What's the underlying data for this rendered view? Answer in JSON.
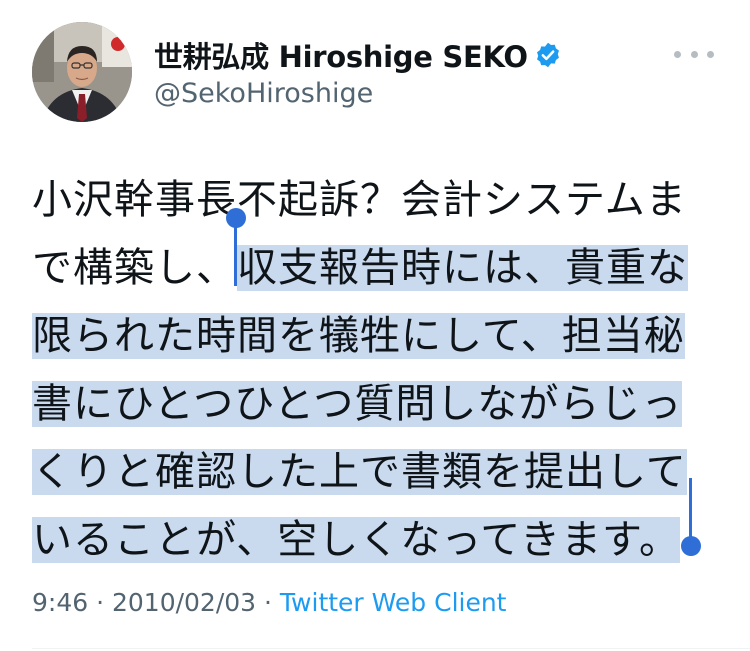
{
  "author": {
    "display_name": "世耕弘成 Hiroshige SEKO",
    "handle": "@SekoHiroshige",
    "verified": true,
    "avatar_icon": "profile-photo"
  },
  "more_icon": "ellipsis-icon",
  "tweet": {
    "lines": [
      {
        "plain": "小沢幹事長不起訴？会計システムま",
        "selected": ""
      },
      {
        "plain": "で構築し、",
        "selected": "収支報告時には、貴重な"
      },
      {
        "plain": "",
        "selected": "限られた時間を犠牲にして、担当秘"
      },
      {
        "plain": "",
        "selected": "書にひとつひとつ質問しながらじっ"
      },
      {
        "plain": "",
        "selected": "くりと確認した上で書類を提出して"
      },
      {
        "plain": "",
        "selected": "いることが、空しくなってきます。"
      }
    ]
  },
  "meta": {
    "time": "9:46",
    "separator1": " · ",
    "date": "2010/02/03",
    "separator2": " · ",
    "client": "Twitter Web Client"
  },
  "colors": {
    "selection": "#c9d9ee",
    "selection_handle": "#2f6ed6",
    "verified_badge": "#1d9bf0",
    "link": "#1d9bf0",
    "secondary_text": "#536471"
  }
}
